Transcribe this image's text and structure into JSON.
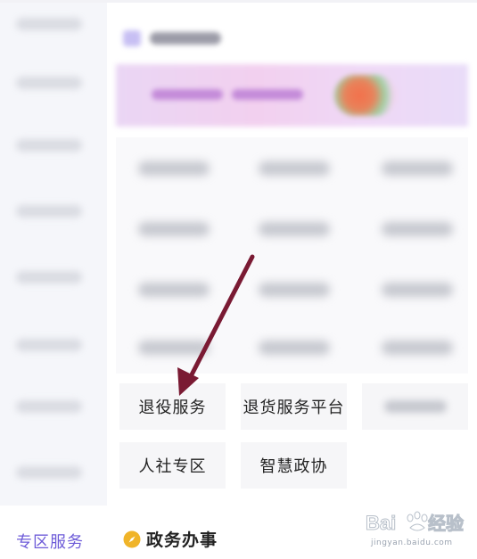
{
  "services": {
    "row1": [
      {
        "label": "退役服务"
      },
      {
        "label": "退货服务平台"
      },
      {
        "label": ""
      }
    ],
    "row2": [
      {
        "label": "人社专区"
      },
      {
        "label": "智慧政协"
      }
    ]
  },
  "bottom": {
    "zone_tab": "专区服务",
    "section_title": "政务办事",
    "section_icon": "compass-icon"
  },
  "watermark": {
    "brand": "Baidu经验",
    "url": "jingyan.baidu.com"
  },
  "colors": {
    "accent": "#6d5bd8",
    "arrow": "#7a1a33",
    "compass": "#f0b429"
  }
}
